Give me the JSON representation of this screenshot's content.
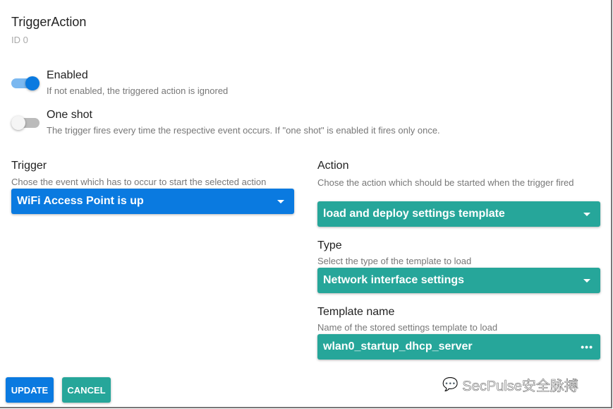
{
  "dialog": {
    "title": "TriggerAction",
    "id_label": "ID 0"
  },
  "enabled": {
    "label": "Enabled",
    "description": "If not enabled, the triggered action is ignored",
    "value": true
  },
  "one_shot": {
    "label": "One shot",
    "description": "The trigger fires every time the respective event occurs. If \"one shot\" is enabled it fires only once.",
    "value": false
  },
  "trigger": {
    "label": "Trigger",
    "description": "Chose the event which has to occur to start the selected action",
    "value": "WiFi Access Point is up"
  },
  "action": {
    "label": "Action",
    "description": "Chose the action which should be started when the trigger fired",
    "value": "load and deploy settings template"
  },
  "type": {
    "label": "Type",
    "description": "Select the type of the template to load",
    "value": "Network interface settings"
  },
  "template": {
    "label": "Template name",
    "description": "Name of the stored settings template to load",
    "value": "wlan0_startup_dhcp_server"
  },
  "buttons": {
    "update": "UPDATE",
    "cancel": "CANCEL"
  },
  "watermark": "SecPulse安全脉搏",
  "colors": {
    "blue": "#0a7ae0",
    "teal": "#26a69a"
  }
}
